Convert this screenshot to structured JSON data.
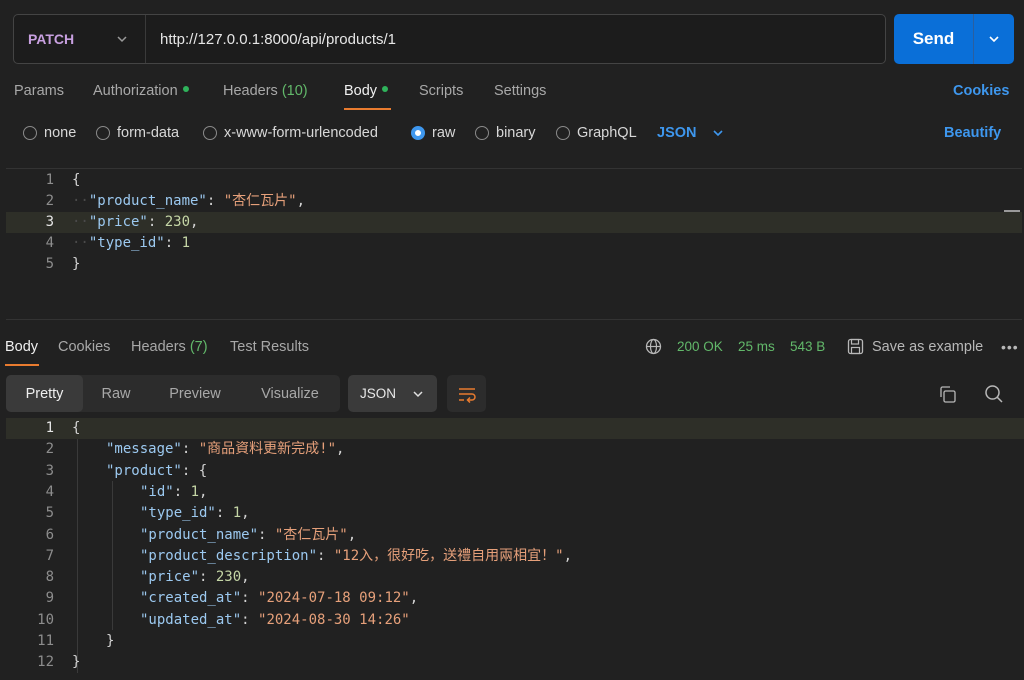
{
  "request": {
    "method": "PATCH",
    "url": "http://127.0.0.1:8000/api/products/1",
    "send_label": "Send"
  },
  "request_tabs": {
    "params": "Params",
    "authorization": "Authorization",
    "headers": "Headers",
    "headers_count": "(10)",
    "body": "Body",
    "scripts": "Scripts",
    "settings": "Settings",
    "cookies": "Cookies"
  },
  "body_types": {
    "none": "none",
    "form_data": "form-data",
    "urlencoded": "x-www-form-urlencoded",
    "raw": "raw",
    "binary": "binary",
    "graphql": "GraphQL",
    "format": "JSON",
    "beautify": "Beautify",
    "selected": "raw"
  },
  "request_body": {
    "line_numbers": [
      "1",
      "2",
      "3",
      "4",
      "5"
    ],
    "lines": [
      {
        "open": "{"
      },
      {
        "key": "\"product_name\"",
        "sep": ": ",
        "str": "\"杏仁瓦片\"",
        "end": ","
      },
      {
        "key": "\"price\"",
        "sep": ": ",
        "num": "230",
        "end": ","
      },
      {
        "key": "\"type_id\"",
        "sep": ": ",
        "num": "1",
        "end": ""
      },
      {
        "open": "}"
      }
    ]
  },
  "response_tabs": {
    "body": "Body",
    "cookies": "Cookies",
    "headers": "Headers",
    "headers_count": "(7)",
    "test_results": "Test Results",
    "status": "200 OK",
    "time": "25 ms",
    "size": "543 B",
    "save_example": "Save as example"
  },
  "view_modes": {
    "pretty": "Pretty",
    "raw": "Raw",
    "preview": "Preview",
    "visualize": "Visualize",
    "format": "JSON"
  },
  "response_body": {
    "line_numbers": [
      "1",
      "2",
      "3",
      "4",
      "5",
      "6",
      "7",
      "8",
      "9",
      "10",
      "11",
      "12"
    ],
    "l1": "{",
    "message_key": "\"message\"",
    "message_val": "\"商品資料更新完成!\"",
    "product_key": "\"product\"",
    "id_key": "\"id\"",
    "id_val": "1",
    "type_id_key": "\"type_id\"",
    "type_id_val": "1",
    "product_name_key": "\"product_name\"",
    "product_name_val": "\"杏仁瓦片\"",
    "product_description_key": "\"product_description\"",
    "product_description_val": "\"12入，很好吃，送禮自用兩相宜！\"",
    "price_key": "\"price\"",
    "price_val": "230",
    "created_at_key": "\"created_at\"",
    "created_at_val": "\"2024-07-18 09:12\"",
    "updated_at_key": "\"updated_at\"",
    "updated_at_val": "\"2024-08-30 14:26\"",
    "close_inner": "}",
    "close_outer": "}"
  },
  "colors": {
    "accent": "#0a6fd8",
    "link": "#3e97ee",
    "success": "#62b86a",
    "tab_underline": "#e87b2f"
  }
}
